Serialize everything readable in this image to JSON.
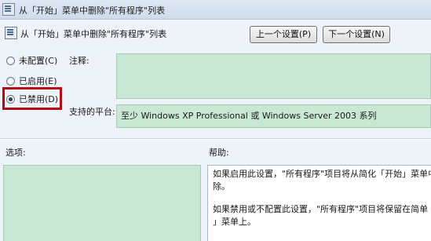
{
  "window": {
    "title": "从「开始」菜单中删除\"所有程序\"列表"
  },
  "header": {
    "title": "从「开始」菜单中删除\"所有程序\"列表",
    "prev_button": "上一个设置(P)",
    "next_button": "下一个设置(N)"
  },
  "radios": {
    "not_configured": "未配置(C)",
    "enabled": "已启用(E)",
    "disabled": "已禁用(D)",
    "selected": "disabled"
  },
  "labels": {
    "comment": "注释:",
    "supported_on": "支持的平台:",
    "options": "选项:",
    "help": "帮助:"
  },
  "supported_on_text": "至少 Windows XP Professional 或 Windows Server 2003 系列",
  "comment_text": "",
  "help": {
    "para1_line1": "如果启用此设置，\"所有程序\"项目将从简化「开始」菜单中被",
    "para1_line2": "除。",
    "para2_line1": "如果禁用或不配置此设置，\"所有程序\"项目将保留在简单「开",
    "para2_line2": "」菜单上。"
  },
  "colors": {
    "field_bg": "#c8e8d3",
    "highlight": "#b30d12",
    "window_bg": "#eef3f9"
  }
}
